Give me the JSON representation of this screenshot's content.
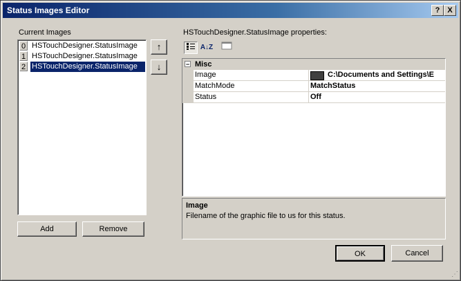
{
  "window": {
    "title": "Status Images Editor",
    "help_glyph": "?",
    "close_glyph": "X"
  },
  "left": {
    "label": "Current Images",
    "items": [
      {
        "index": "0",
        "text": "HSTouchDesigner.StatusImage"
      },
      {
        "index": "1",
        "text": "HSTouchDesigner.StatusImage"
      },
      {
        "index": "2",
        "text": "HSTouchDesigner.StatusImage",
        "selected": true
      }
    ],
    "add_label": "Add",
    "remove_label": "Remove",
    "up_glyph": "↑",
    "down_glyph": "↓"
  },
  "right": {
    "label": "HSTouchDesigner.StatusImage properties:",
    "toolbar": {
      "categorized_icon": "categorized-icon",
      "alphabetical_icon": "sort-az-icon",
      "alphabetical_glyph": "A↓Z",
      "pages_icon": "property-pages-icon"
    },
    "grid": {
      "category": "Misc",
      "expander_glyph": "−",
      "rows": [
        {
          "name": "Image",
          "value": "C:\\Documents and Settings\\E",
          "has_thumbnail": true
        },
        {
          "name": "MatchMode",
          "value": "MatchStatus"
        },
        {
          "name": "Status",
          "value": "Off"
        }
      ]
    },
    "help": {
      "title": "Image",
      "description": "Filename of the graphic file to us for this status."
    }
  },
  "footer": {
    "ok_label": "OK",
    "cancel_label": "Cancel"
  }
}
